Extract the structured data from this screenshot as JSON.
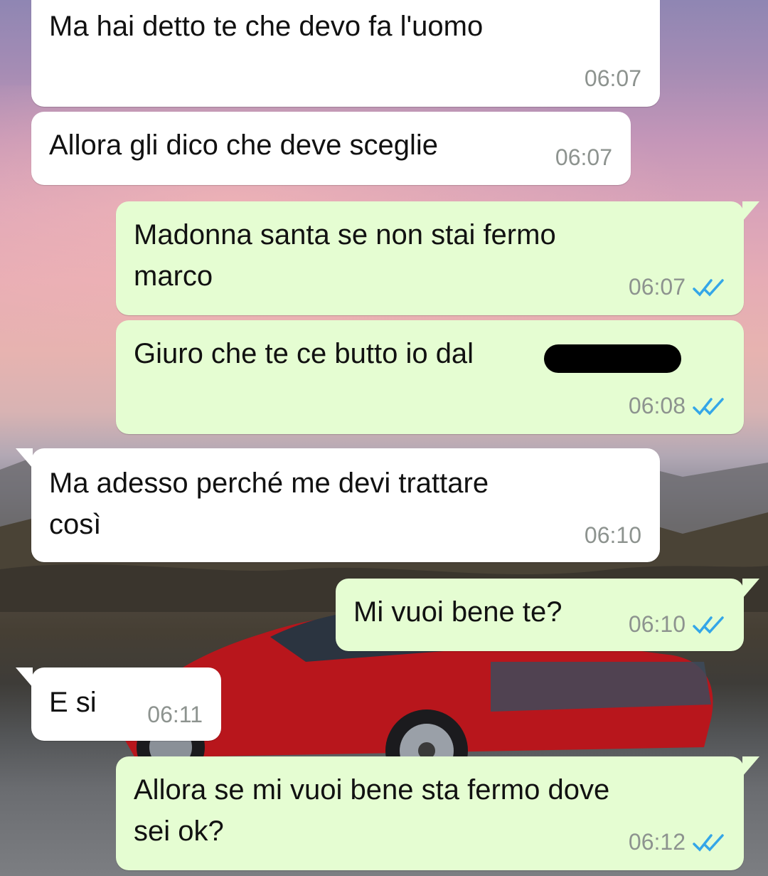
{
  "chat": {
    "messages": [
      {
        "direction": "incoming",
        "text": "Ma hai detto te che devo fa l'uomo",
        "time": "06:07"
      },
      {
        "direction": "incoming",
        "text": "Allora gli dico che deve sceglie",
        "time": "06:07"
      },
      {
        "direction": "outgoing",
        "text": "Madonna santa se non stai fermo\nmarco",
        "time": "06:07",
        "status": "read"
      },
      {
        "direction": "outgoing",
        "text": "Giuro che te ce butto io dal",
        "time": "06:08",
        "status": "read",
        "redacted_tail": true
      },
      {
        "direction": "incoming",
        "text": "Ma adesso perché me devi trattare\ncosì",
        "time": "06:10"
      },
      {
        "direction": "outgoing",
        "text": "Mi vuoi bene te?",
        "time": "06:10",
        "status": "read"
      },
      {
        "direction": "incoming",
        "text": "E si",
        "time": "06:11"
      },
      {
        "direction": "outgoing",
        "text": "Allora se mi vuoi bene sta fermo dove\nsei ok?",
        "time": "06:12",
        "status": "read"
      }
    ]
  },
  "colors": {
    "incoming_bubble": "#ffffff",
    "outgoing_bubble": "#e5fdd2",
    "timestamp": "#8d938f",
    "read_ticks": "#34a6e8"
  },
  "icons": {
    "read_receipt": "double-check-icon",
    "wallpaper": "red-sports-car-mountain-sunset"
  }
}
